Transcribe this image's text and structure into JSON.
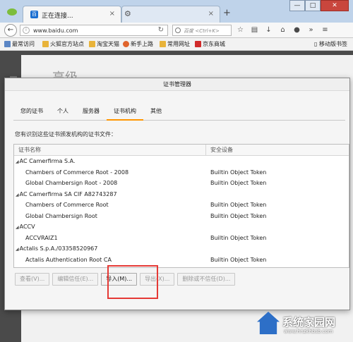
{
  "browser": {
    "tab_title": "正在连接...",
    "tab_close": "×",
    "new_tab": "+",
    "win_min": "—",
    "win_max": "□",
    "win_close": "✕",
    "url": "www.baidu.com",
    "search_placeholder": "百度 <Ctrl+K>",
    "bookmarks": [
      "最常访问",
      "火狐官方站点",
      "淘宝天猫",
      "新手上路",
      "常用网址",
      "京东商城"
    ],
    "mobile_bookmarks": "移动版书签"
  },
  "page": {
    "title_partial": "高级"
  },
  "dialog": {
    "title": "证书管理器",
    "tabs": [
      "您的证书",
      "个人",
      "服务器",
      "证书机构",
      "其他"
    ],
    "active_tab": "证书机构",
    "description": "您有识别这些证书颁发机构的证书文件：",
    "columns": [
      "证书名称",
      "安全设备"
    ],
    "rows": [
      {
        "type": "group",
        "name": "AC Camerfirma S.A.",
        "device": ""
      },
      {
        "type": "child",
        "name": "Chambers of Commerce Root - 2008",
        "device": "Builtin Object Token"
      },
      {
        "type": "child",
        "name": "Global Chambersign Root - 2008",
        "device": "Builtin Object Token"
      },
      {
        "type": "group",
        "name": "AC Camerfirma SA CIF A82743287",
        "device": ""
      },
      {
        "type": "child",
        "name": "Chambers of Commerce Root",
        "device": "Builtin Object Token"
      },
      {
        "type": "child",
        "name": "Global Chambersign Root",
        "device": "Builtin Object Token"
      },
      {
        "type": "group",
        "name": "ACCV",
        "device": ""
      },
      {
        "type": "child",
        "name": "ACCVRAIZ1",
        "device": "Builtin Object Token"
      },
      {
        "type": "group",
        "name": "Actalis S.p.A./03358520967",
        "device": ""
      },
      {
        "type": "child",
        "name": "Actalis Authentication Root CA",
        "device": "Builtin Object Token"
      }
    ],
    "buttons": {
      "view": "查看(V)...",
      "edit_trust": "编辑信任(E)...",
      "import": "导入(M)...",
      "export": "导出(X)...",
      "delete": "删除或不信任(D)..."
    }
  },
  "watermark": {
    "text": "系统家园网",
    "url": "www.hnzkhbsb.com"
  }
}
